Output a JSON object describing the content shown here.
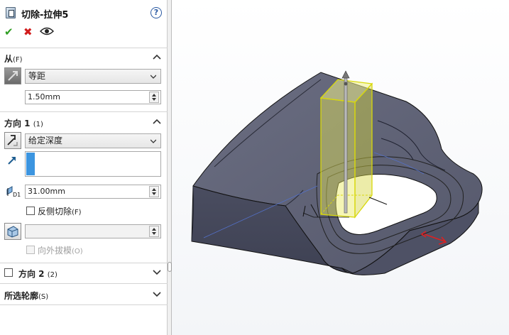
{
  "header": {
    "title": "切除-拉伸5",
    "help_label": "?",
    "ok_label": "✔",
    "cancel_label": "✖"
  },
  "from": {
    "title": "从",
    "shortcut": "(F)",
    "condition": "等距",
    "offset_value": "1.50mm"
  },
  "direction1": {
    "title": "方向 1",
    "shortcut": "(1)",
    "end_condition": "给定深度",
    "depth_value": "31.00mm",
    "flip_side_label": "反侧切除",
    "flip_side_shortcut": "(F)",
    "flip_side_checked": false,
    "draft_value": "",
    "draft_outward_label": "向外拔模",
    "draft_outward_shortcut": "(O)",
    "draft_outward_enabled": false
  },
  "direction2": {
    "title": "方向 2",
    "shortcut": "(2)",
    "checked": false,
    "collapsed": true
  },
  "selected_contours": {
    "title": "所选轮廓",
    "shortcut": "(S)",
    "collapsed": true
  },
  "colors": {
    "accent_blue": "#3c95e0",
    "ok_green": "#2f9e22",
    "cancel_red": "#d11c1c",
    "part_body": "#5f6275",
    "preview_yellow": "#e8e85a"
  },
  "icons": {
    "feature": "extruded-cut-icon",
    "help": "help-circle-icon",
    "eye": "preview-eye-icon"
  }
}
